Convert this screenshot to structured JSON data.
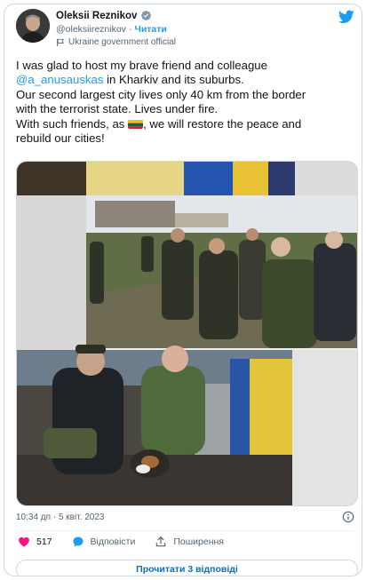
{
  "author": {
    "display_name": "Oleksii Reznikov",
    "handle": "@oleksiireznikov",
    "separator": "·",
    "follow_label": "Читати",
    "affiliation": "Ukraine government official"
  },
  "tweet": {
    "line1": "I was glad to host my brave friend and colleague",
    "mention": "@a_anusauskas",
    "line2_rest": " in Kharkiv and its suburbs.",
    "line3": "Our second largest city lives only 40 km from the border",
    "line4": "with the terrorist state. Lives under fire.",
    "line5_before_flag": "With such friends, as ",
    "line5_after_flag": ", we will restore the peace and",
    "line6": "rebuild our cities!"
  },
  "timestamp": "10:34 дп · 5 квіт. 2023",
  "actions": {
    "like_count": "517",
    "reply_label": "Відповісти",
    "share_label": "Поширення"
  },
  "read_replies_label": "Прочитати 3 відповіді",
  "colors": {
    "accent": "#1d9bf0",
    "like": "#f91880",
    "border": "#cfd9de"
  },
  "icons": [
    "verified-badge-icon",
    "twitter-bird-icon",
    "government-flag-icon",
    "info-icon",
    "heart-icon",
    "reply-bubble-icon",
    "share-icon"
  ]
}
